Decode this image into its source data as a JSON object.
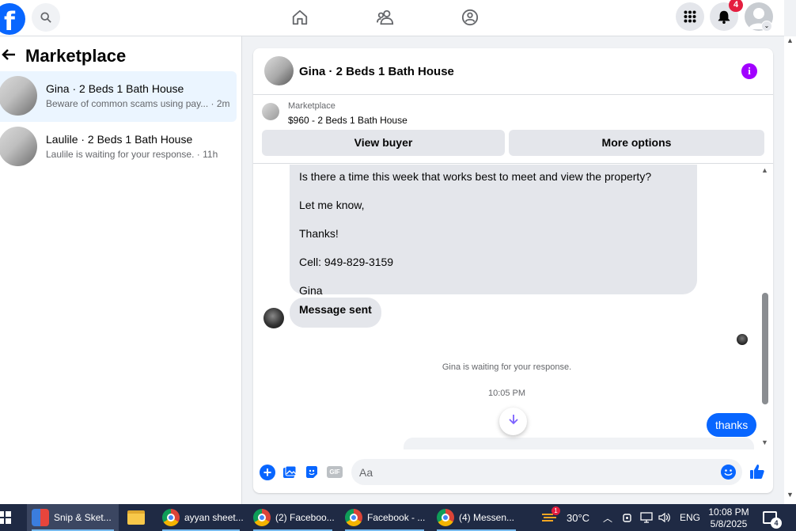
{
  "topbar": {
    "logo_letter": "f",
    "notification_count": "4"
  },
  "sidebar": {
    "title": "Marketplace",
    "conversations": [
      {
        "name": "Gina · 2 Beds 1 Bath House",
        "snippet": "Beware of common scams using pay...",
        "time": "· 2m",
        "active": true
      },
      {
        "name": "Laulile · 2 Beds 1 Bath House",
        "snippet": "Laulile is waiting for your response.",
        "time": "· 11h",
        "active": false
      }
    ]
  },
  "chat": {
    "title": "Gina · 2 Beds 1 Bath House",
    "info_glyph": "i",
    "listing": {
      "label": "Marketplace",
      "price_title": "$960 - 2 Beds 1 Bath House"
    },
    "buttons": {
      "view_buyer": "View buyer",
      "more_options": "More options"
    },
    "message_lines": [
      "Is there a time this week that works best to meet and view the property?",
      "Let me know,",
      "Thanks!",
      "Cell: 949-829-3159",
      "Gina"
    ],
    "sent_notice": "Message sent",
    "waiting_text": "Gina is waiting for your response.",
    "timestamp": "10:05 PM",
    "my_message": "thanks",
    "composer": {
      "placeholder": "Aa",
      "gif_label": "GIF"
    }
  },
  "taskbar": {
    "items": [
      {
        "label": "Snip & Sket...",
        "icon": "snip-icon"
      },
      {
        "label": "",
        "icon": "folder-icon"
      },
      {
        "label": "ayyan sheet...",
        "icon": "chrome-icon"
      },
      {
        "label": "(2) Faceboo...",
        "icon": "chrome-icon"
      },
      {
        "label": "Facebook - ...",
        "icon": "chrome-icon"
      },
      {
        "label": "(4) Messen...",
        "icon": "chrome-icon"
      }
    ],
    "weather_temp": "30°C",
    "weather_badge": "1",
    "language": "ENG",
    "time": "10:08 PM",
    "date": "5/8/2025",
    "notification_count": "4"
  }
}
